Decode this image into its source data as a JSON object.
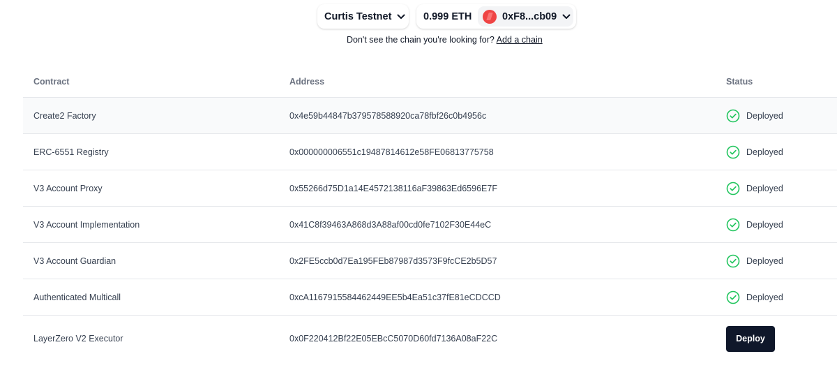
{
  "header": {
    "chain_name": "Curtis Testnet",
    "balance": "0.999 ETH",
    "account": "0xF8...cb09",
    "hint_text": "Don't see the chain you're looking for?",
    "hint_link": "Add a chain"
  },
  "table": {
    "columns": [
      "Contract",
      "Address",
      "Status"
    ],
    "rows": [
      {
        "contract": "Create2 Factory",
        "address": "0x4e59b44847b379578588920ca78fbf26c0b4956c",
        "status": "Deployed"
      },
      {
        "contract": "ERC-6551 Registry",
        "address": "0x000000006551c19487814612e58FE06813775758",
        "status": "Deployed"
      },
      {
        "contract": "V3 Account Proxy",
        "address": "0x55266d75D1a14E4572138116aF39863Ed6596E7F",
        "status": "Deployed"
      },
      {
        "contract": "V3 Account Implementation",
        "address": "0x41C8f39463A868d3A88af00cd0fe7102F30E44eC",
        "status": "Deployed"
      },
      {
        "contract": "V3 Account Guardian",
        "address": "0x2FE5ccb0d7Ea195FEb87987d3573F9fcCE2b5D57",
        "status": "Deployed"
      },
      {
        "contract": "Authenticated Multicall",
        "address": "0xcA1167915584462449EE5b4Ea51c37fE81eCDCCD",
        "status": "Deployed"
      },
      {
        "contract": "LayerZero V2 Executor",
        "address": "0x0F220412Bf22E05EBcC5070D60fd7136A08aF22C",
        "status_button": "Deploy"
      }
    ]
  },
  "colors": {
    "deployed_green": "#22c55e",
    "deploy_button_bg": "#0f172a",
    "avatar_red": "#ef4444"
  },
  "icons": {
    "chain_dropdown": "chevron-down-icon",
    "account_dropdown": "chevron-down-icon",
    "status_deployed": "check-circle-icon"
  }
}
